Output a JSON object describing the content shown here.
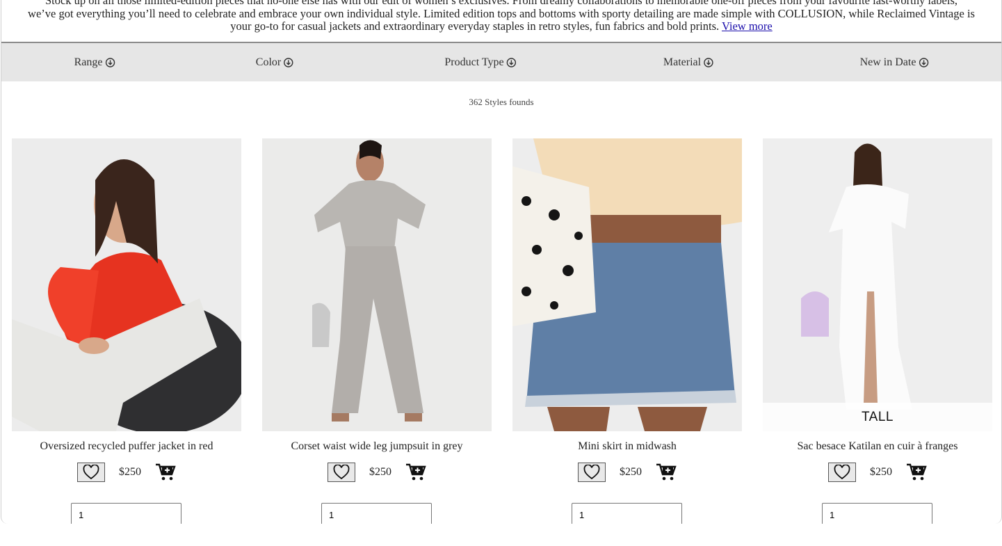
{
  "intro": {
    "line1": "Stock up on all those limited-edition pieces that no-one else has with our edit of women’s exclusives. From dreamy collaborations to memorable one-off pieces from your favourite last-worthy labels,",
    "line2": "we’ve got everything you’ll need to celebrate and embrace your own individual style. Limited edition tops and bottoms with sporty detailing are made simple with COLLUSION, while Reclaimed Vintage is",
    "line3": "your go-to for casual jackets and extraordinary everyday staples in retro styles, fun fabrics and bold prints.",
    "view_more": "View more"
  },
  "filters": [
    {
      "label": "Range",
      "icon": "circle-down-arrow-icon"
    },
    {
      "label": "Color",
      "icon": "circle-down-arrow-icon"
    },
    {
      "label": "Product Type",
      "icon": "circle-down-arrow-icon"
    },
    {
      "label": "Material",
      "icon": "circle-down-arrow-icon"
    },
    {
      "label": "New in Date",
      "icon": "circle-down-arrow-icon"
    }
  ],
  "results": {
    "count_text": "362 Styles founds"
  },
  "products": [
    {
      "title": "Oversized recycled puffer jacket in red",
      "price": "$250",
      "quantity": "1"
    },
    {
      "title": "Corset waist wide leg jumpsuit in grey",
      "price": "$250",
      "quantity": "1"
    },
    {
      "title": "Mini skirt in midwash",
      "price": "$250",
      "quantity": "1"
    },
    {
      "title": "Sac besace Katilan en cuir à franges",
      "price": "$250",
      "quantity": "1",
      "badge": "TALL"
    }
  ],
  "icons": {
    "favorite": "heart-outline-icon",
    "cart": "add-to-cart-icon"
  },
  "colors": {
    "filter_bar": "#e6e6e6",
    "link": "#1a0dab",
    "jacket": "#e63320",
    "denim": "#5f7fa6"
  }
}
